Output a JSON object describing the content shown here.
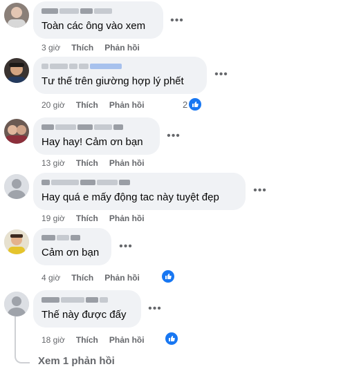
{
  "comments": [
    {
      "text": "Toàn các ông vào xem",
      "time": "3 giờ",
      "like": "Thích",
      "reply": "Phản hồi"
    },
    {
      "text": "Tư thế trên giường hợp lý phết",
      "time": "20 giờ",
      "like": "Thích",
      "reply": "Phản hồi",
      "reaction_count": "2"
    },
    {
      "text": "Hay hay! Cảm ơn bạn",
      "time": "13 giờ",
      "like": "Thích",
      "reply": "Phản hồi"
    },
    {
      "text": "Hay quá e mấy động tac này tuyệt đẹp",
      "time": "19 giờ",
      "like": "Thích",
      "reply": "Phản hồi"
    },
    {
      "text": "Cảm ơn bạn",
      "time": "4 giờ",
      "like": "Thích",
      "reply": "Phản hồi"
    },
    {
      "text": "Thế này được đấy",
      "time": "18 giờ",
      "like": "Thích",
      "reply": "Phản hồi"
    }
  ],
  "view_replies": "Xem 1 phản hồi",
  "colors": {
    "accent": "#1877f2",
    "bubble": "#f0f2f5",
    "meta": "#65676b"
  },
  "icons": [
    "more-dots-icon",
    "like-reaction-icon",
    "default-avatar-icon"
  ]
}
